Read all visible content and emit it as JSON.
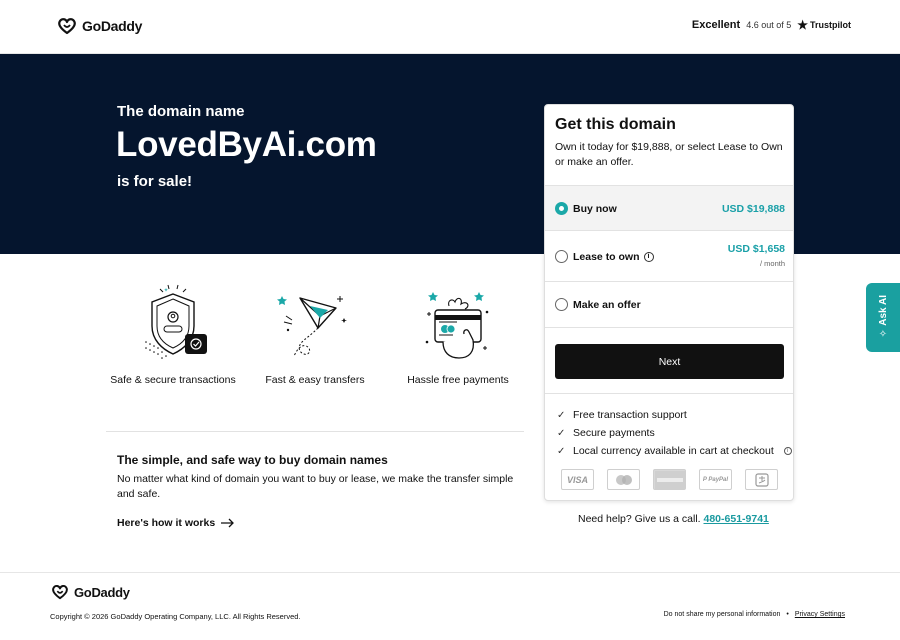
{
  "header": {
    "brand": "GoDaddy",
    "rating_label": "Excellent",
    "rating_score": "4.6 out of 5",
    "rating_provider": "Trustpilot"
  },
  "hero": {
    "pre": "The domain name",
    "domain": "LovedByAi.com",
    "post": "is for sale!"
  },
  "features": [
    {
      "label": "Safe & secure transactions",
      "icon": "shield-icon"
    },
    {
      "label": "Fast & easy transfers",
      "icon": "paper-plane-icon"
    },
    {
      "label": "Hassle free payments",
      "icon": "card-payment-icon"
    }
  ],
  "info": {
    "title": "The simple, and safe way to buy domain names",
    "body": "No matter what kind of domain you want to buy or lease, we make the transfer simple and safe.",
    "link": "Here's how it works"
  },
  "card": {
    "title": "Get this domain",
    "description": "Own it today for $19,888, or select Lease to Own or make an offer.",
    "options": [
      {
        "label": "Buy now",
        "price": "USD $19,888",
        "selected": true
      },
      {
        "label": "Lease to own",
        "price": "USD $1,658",
        "sub": "/ month",
        "selected": false
      },
      {
        "label": "Make an offer",
        "selected": false
      }
    ],
    "next_label": "Next",
    "benefits": [
      "Free transaction support",
      "Secure payments",
      "Local currency available in cart at checkout"
    ],
    "payment_methods": [
      "VISA",
      "Mastercard",
      "American Express",
      "PayPal",
      "Alipay"
    ]
  },
  "help": {
    "text": "Need help? Give us a call.",
    "phone": "480-651-9741"
  },
  "ask_ai": {
    "label": "Ask AI"
  },
  "footer": {
    "brand": "GoDaddy",
    "copyright": "Copyright © 2026 GoDaddy Operating Company, LLC. All Rights Reserved.",
    "do_not_share": "Do not share my personal information",
    "privacy": "Privacy Settings"
  },
  "colors": {
    "hero_bg": "#05152e",
    "accent_teal": "#1aa0a8",
    "button_dark": "#111111"
  }
}
